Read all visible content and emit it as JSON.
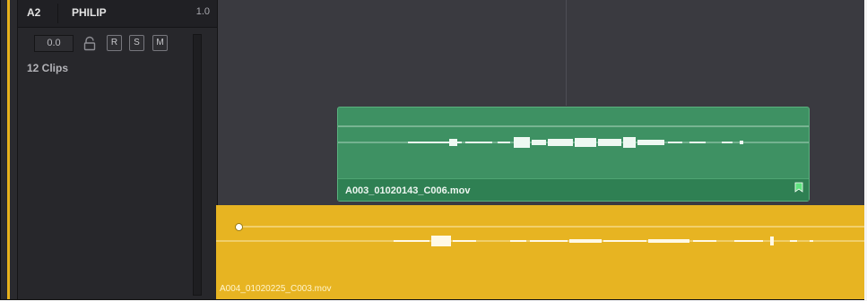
{
  "track": {
    "id": "A2",
    "name": "PHILIP",
    "channel_format": "1.0",
    "volume": "0.0",
    "record_label": "R",
    "solo_label": "S",
    "mute_label": "M",
    "clip_count": "12 Clips"
  },
  "clips": {
    "upper": {
      "name": "A003_01020143_C006.mov",
      "color": "#3e9163"
    },
    "lower": {
      "name": "A004_01020225_C003.mov",
      "color": "#e7b422"
    }
  },
  "icons": {
    "lock": "lock-icon",
    "flag": "flag-icon",
    "keyframe": "keyframe-dot"
  },
  "colors": {
    "selection_accent": "#e8b21c",
    "timeline_bg": "#3a3a40",
    "header_bg": "#27272b"
  }
}
